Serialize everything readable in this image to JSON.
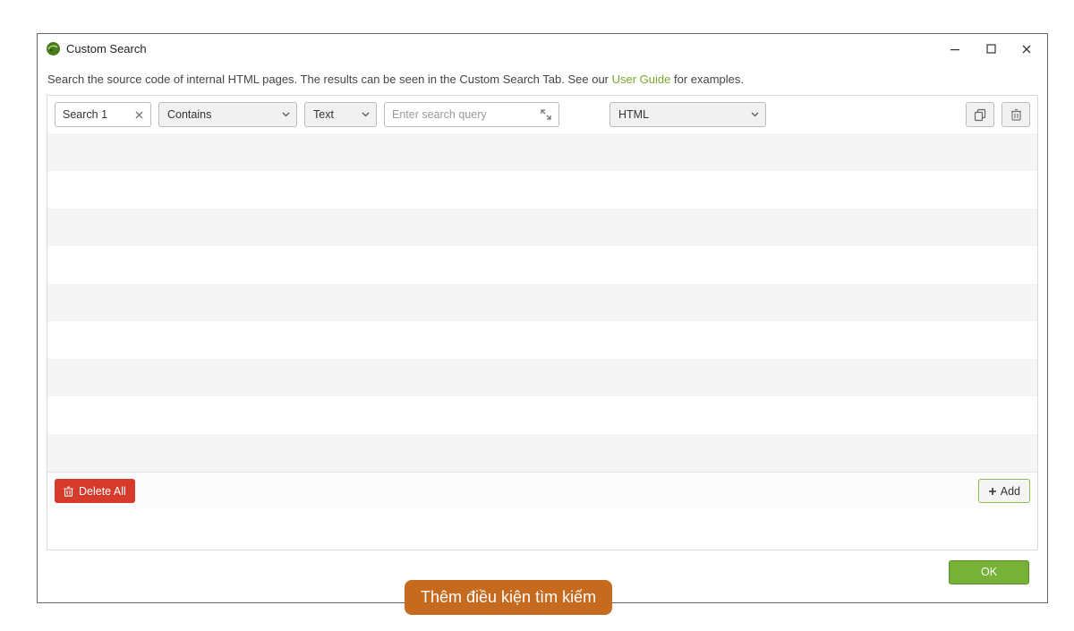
{
  "window": {
    "title": "Custom Search"
  },
  "description": {
    "before_link": "Search the source code of internal HTML pages. The results can be seen in the Custom Search Tab. See our ",
    "link_text": "User Guide",
    "after_link": " for examples."
  },
  "row": {
    "name": "Search 1",
    "mode": "Contains",
    "type": "Text",
    "query_placeholder": "Enter search query",
    "target": "HTML"
  },
  "footer": {
    "delete_all": "Delete All",
    "add": "Add"
  },
  "actions": {
    "ok": "OK"
  },
  "tooltip": "Thêm điều kiện tìm kiếm"
}
